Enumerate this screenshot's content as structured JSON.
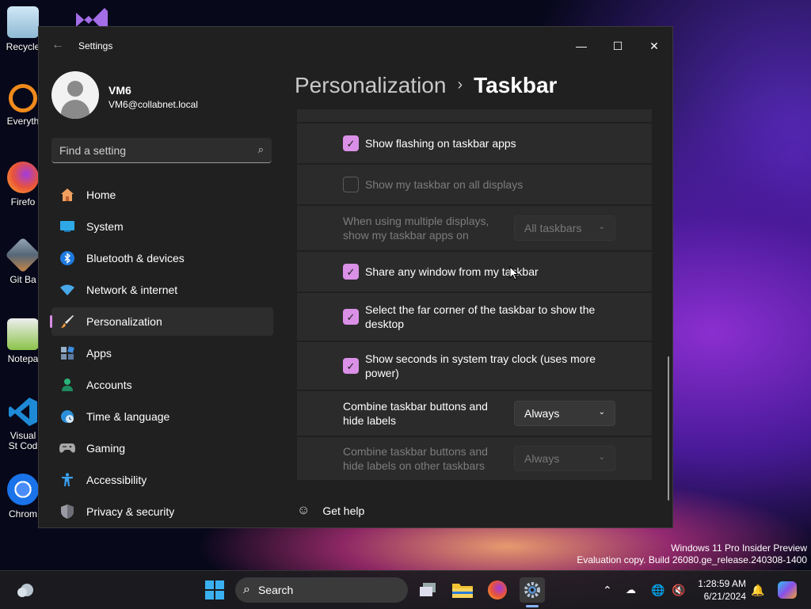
{
  "desktop": {
    "icons": [
      {
        "label": "Recycle",
        "icon": "recycle-bin-icon"
      },
      {
        "label": "Everyth",
        "icon": "everything-search-icon"
      },
      {
        "label": "Firefo",
        "icon": "firefox-icon"
      },
      {
        "label": "Git Ba",
        "icon": "git-bash-icon"
      },
      {
        "label": "Notepa",
        "icon": "notepad-plus-icon"
      },
      {
        "label": "Visual St Cod",
        "icon": "vscode-icon"
      },
      {
        "label": "Chrom",
        "icon": "chrome-icon"
      }
    ],
    "watermark": {
      "line1": "Windows 11 Pro Insider Preview",
      "line2": "Evaluation copy. Build 26080.ge_release.240308-1400"
    }
  },
  "window": {
    "title": "Settings",
    "controls": {
      "minimize": "—",
      "maximize": "☐",
      "close": "✕"
    }
  },
  "profile": {
    "name": "VM6",
    "email": "VM6@collabnet.local"
  },
  "search": {
    "placeholder": "Find a setting"
  },
  "sidebar": {
    "items": [
      {
        "label": "Home",
        "icon": "home-icon"
      },
      {
        "label": "System",
        "icon": "system-icon"
      },
      {
        "label": "Bluetooth & devices",
        "icon": "bluetooth-icon"
      },
      {
        "label": "Network & internet",
        "icon": "wifi-icon"
      },
      {
        "label": "Personalization",
        "icon": "brush-icon",
        "active": true
      },
      {
        "label": "Apps",
        "icon": "apps-icon"
      },
      {
        "label": "Accounts",
        "icon": "accounts-icon"
      },
      {
        "label": "Time & language",
        "icon": "globe-clock-icon"
      },
      {
        "label": "Gaming",
        "icon": "gamepad-icon"
      },
      {
        "label": "Accessibility",
        "icon": "accessibility-icon"
      },
      {
        "label": "Privacy & security",
        "icon": "shield-icon"
      }
    ]
  },
  "breadcrumb": {
    "parent": "Personalization",
    "separator": "›",
    "current": "Taskbar"
  },
  "settings": {
    "flashing": {
      "label": "Show flashing on taskbar apps",
      "checked": true
    },
    "all_displays": {
      "label": "Show my taskbar on all displays",
      "checked": false,
      "disabled": true
    },
    "multi_display": {
      "line1": "When using multiple displays,",
      "line2": "show my taskbar apps on",
      "value": "All taskbars",
      "disabled": true
    },
    "share_window": {
      "label": "Share any window from my taskbar",
      "checked": true
    },
    "far_corner": {
      "line1": "Select the far corner of the taskbar to show the",
      "line2": "desktop",
      "checked": true
    },
    "seconds": {
      "line1": "Show seconds in system tray clock (uses more",
      "line2": "power)",
      "checked": true
    },
    "combine": {
      "line1": "Combine taskbar buttons and",
      "line2": "hide labels",
      "value": "Always"
    },
    "combine_other": {
      "line1": "Combine taskbar buttons and",
      "line2": "hide labels on other taskbars",
      "value": "Always",
      "disabled": true
    }
  },
  "help": {
    "label": "Get help"
  },
  "taskbar": {
    "search_label": "Search",
    "clock_time": "1:28:59 AM",
    "clock_date": "6/21/2024"
  },
  "colors": {
    "accent": "#d990e6",
    "window_bg": "#202020",
    "card_bg": "#2b2b2b"
  }
}
